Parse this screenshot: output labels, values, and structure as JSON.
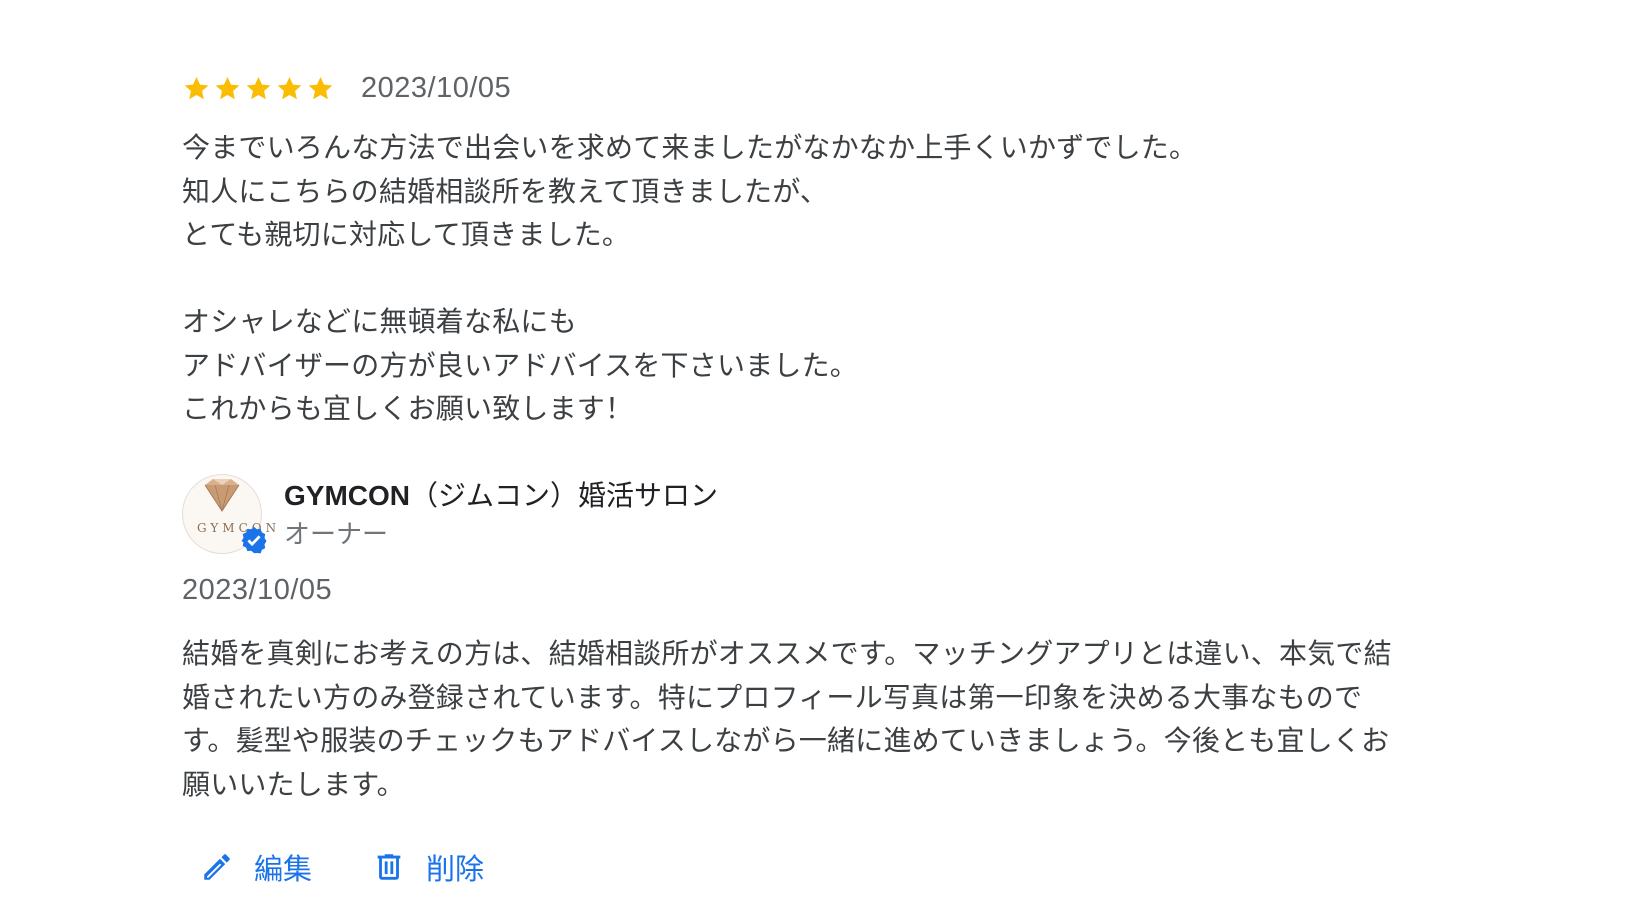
{
  "review": {
    "rating": 5,
    "rating_max": 5,
    "star_color": "#fbbc04",
    "date": "2023/10/05",
    "body_lines": [
      "今までいろんな方法で出会いを求めて来ましたがなかなか上手くいかずでした。",
      "知人にこちらの結婚相談所を教えて頂きましたが、",
      "とても親切に対応して頂きました。",
      "",
      "オシャレなどに無頓着な私にも",
      "アドバイザーの方が良いアドバイスを下さいました。",
      "これからも宜しくお願い致します！"
    ]
  },
  "owner_reply": {
    "name_latin": "GYMCON",
    "name_rest": "（ジムコン）婚活サロン",
    "role": "オーナー",
    "avatar_logo_text": "GYMCON",
    "avatar_icon": "diamond-logo-icon",
    "verified_icon": "verified-badge-icon",
    "verified_color": "#1a73e8",
    "date": "2023/10/05",
    "body_lines": [
      "結婚を真剣にお考えの方は、結婚相談所がオススメです。マッチングアプリとは違い、本気で結",
      "婚されたい方のみ登録されています。特にプロフィール写真は第一印象を決める大事なもので",
      "す。髪型や服装のチェックもアドバイスしながら一緒に進めていきましょう。今後とも宜しくお",
      "願いいたします。"
    ]
  },
  "actions": {
    "edit_label": "編集",
    "edit_icon": "pencil-icon",
    "delete_label": "削除",
    "delete_icon": "trash-icon",
    "accent_color": "#1a73e8"
  }
}
